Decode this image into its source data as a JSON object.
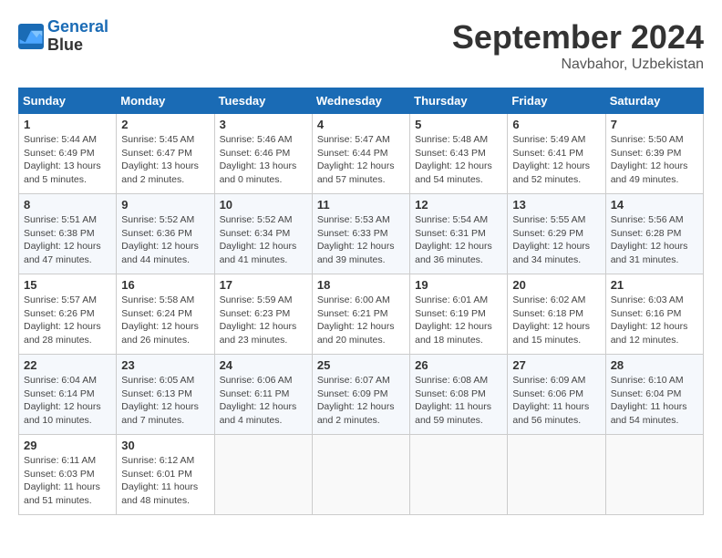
{
  "header": {
    "logo_line1": "General",
    "logo_line2": "Blue",
    "month": "September 2024",
    "location": "Navbahor, Uzbekistan"
  },
  "weekdays": [
    "Sunday",
    "Monday",
    "Tuesday",
    "Wednesday",
    "Thursday",
    "Friday",
    "Saturday"
  ],
  "weeks": [
    [
      {
        "day": "1",
        "info": "Sunrise: 5:44 AM\nSunset: 6:49 PM\nDaylight: 13 hours\nand 5 minutes."
      },
      {
        "day": "2",
        "info": "Sunrise: 5:45 AM\nSunset: 6:47 PM\nDaylight: 13 hours\nand 2 minutes."
      },
      {
        "day": "3",
        "info": "Sunrise: 5:46 AM\nSunset: 6:46 PM\nDaylight: 13 hours\nand 0 minutes."
      },
      {
        "day": "4",
        "info": "Sunrise: 5:47 AM\nSunset: 6:44 PM\nDaylight: 12 hours\nand 57 minutes."
      },
      {
        "day": "5",
        "info": "Sunrise: 5:48 AM\nSunset: 6:43 PM\nDaylight: 12 hours\nand 54 minutes."
      },
      {
        "day": "6",
        "info": "Sunrise: 5:49 AM\nSunset: 6:41 PM\nDaylight: 12 hours\nand 52 minutes."
      },
      {
        "day": "7",
        "info": "Sunrise: 5:50 AM\nSunset: 6:39 PM\nDaylight: 12 hours\nand 49 minutes."
      }
    ],
    [
      {
        "day": "8",
        "info": "Sunrise: 5:51 AM\nSunset: 6:38 PM\nDaylight: 12 hours\nand 47 minutes."
      },
      {
        "day": "9",
        "info": "Sunrise: 5:52 AM\nSunset: 6:36 PM\nDaylight: 12 hours\nand 44 minutes."
      },
      {
        "day": "10",
        "info": "Sunrise: 5:52 AM\nSunset: 6:34 PM\nDaylight: 12 hours\nand 41 minutes."
      },
      {
        "day": "11",
        "info": "Sunrise: 5:53 AM\nSunset: 6:33 PM\nDaylight: 12 hours\nand 39 minutes."
      },
      {
        "day": "12",
        "info": "Sunrise: 5:54 AM\nSunset: 6:31 PM\nDaylight: 12 hours\nand 36 minutes."
      },
      {
        "day": "13",
        "info": "Sunrise: 5:55 AM\nSunset: 6:29 PM\nDaylight: 12 hours\nand 34 minutes."
      },
      {
        "day": "14",
        "info": "Sunrise: 5:56 AM\nSunset: 6:28 PM\nDaylight: 12 hours\nand 31 minutes."
      }
    ],
    [
      {
        "day": "15",
        "info": "Sunrise: 5:57 AM\nSunset: 6:26 PM\nDaylight: 12 hours\nand 28 minutes."
      },
      {
        "day": "16",
        "info": "Sunrise: 5:58 AM\nSunset: 6:24 PM\nDaylight: 12 hours\nand 26 minutes."
      },
      {
        "day": "17",
        "info": "Sunrise: 5:59 AM\nSunset: 6:23 PM\nDaylight: 12 hours\nand 23 minutes."
      },
      {
        "day": "18",
        "info": "Sunrise: 6:00 AM\nSunset: 6:21 PM\nDaylight: 12 hours\nand 20 minutes."
      },
      {
        "day": "19",
        "info": "Sunrise: 6:01 AM\nSunset: 6:19 PM\nDaylight: 12 hours\nand 18 minutes."
      },
      {
        "day": "20",
        "info": "Sunrise: 6:02 AM\nSunset: 6:18 PM\nDaylight: 12 hours\nand 15 minutes."
      },
      {
        "day": "21",
        "info": "Sunrise: 6:03 AM\nSunset: 6:16 PM\nDaylight: 12 hours\nand 12 minutes."
      }
    ],
    [
      {
        "day": "22",
        "info": "Sunrise: 6:04 AM\nSunset: 6:14 PM\nDaylight: 12 hours\nand 10 minutes."
      },
      {
        "day": "23",
        "info": "Sunrise: 6:05 AM\nSunset: 6:13 PM\nDaylight: 12 hours\nand 7 minutes."
      },
      {
        "day": "24",
        "info": "Sunrise: 6:06 AM\nSunset: 6:11 PM\nDaylight: 12 hours\nand 4 minutes."
      },
      {
        "day": "25",
        "info": "Sunrise: 6:07 AM\nSunset: 6:09 PM\nDaylight: 12 hours\nand 2 minutes."
      },
      {
        "day": "26",
        "info": "Sunrise: 6:08 AM\nSunset: 6:08 PM\nDaylight: 11 hours\nand 59 minutes."
      },
      {
        "day": "27",
        "info": "Sunrise: 6:09 AM\nSunset: 6:06 PM\nDaylight: 11 hours\nand 56 minutes."
      },
      {
        "day": "28",
        "info": "Sunrise: 6:10 AM\nSunset: 6:04 PM\nDaylight: 11 hours\nand 54 minutes."
      }
    ],
    [
      {
        "day": "29",
        "info": "Sunrise: 6:11 AM\nSunset: 6:03 PM\nDaylight: 11 hours\nand 51 minutes."
      },
      {
        "day": "30",
        "info": "Sunrise: 6:12 AM\nSunset: 6:01 PM\nDaylight: 11 hours\nand 48 minutes."
      },
      {
        "day": "",
        "info": ""
      },
      {
        "day": "",
        "info": ""
      },
      {
        "day": "",
        "info": ""
      },
      {
        "day": "",
        "info": ""
      },
      {
        "day": "",
        "info": ""
      }
    ]
  ]
}
